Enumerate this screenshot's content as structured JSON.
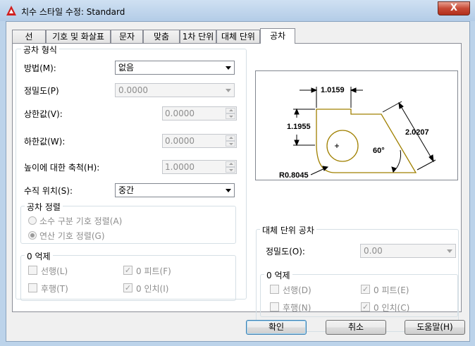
{
  "window": {
    "title": "치수 스타일 수정: Standard",
    "close_glyph": "X"
  },
  "tabs": [
    {
      "label": "선",
      "active": false
    },
    {
      "label": "기호 및 화살표",
      "active": false
    },
    {
      "label": "문자",
      "active": false
    },
    {
      "label": "맞춤",
      "active": false
    },
    {
      "label": "1차 단위",
      "active": false
    },
    {
      "label": "대체 단위",
      "active": false
    },
    {
      "label": "공차",
      "active": true
    }
  ],
  "tolerance_format": {
    "title": "공차 형식",
    "method_label": "방법(M):",
    "method_value": "없음",
    "precision_label": "정밀도(P)",
    "precision_value": "0.0000",
    "upper_label": "상한값(V):",
    "upper_value": "0.0000",
    "lower_label": "하한값(W):",
    "lower_value": "0.0000",
    "scale_label": "높이에 대한 축척(H):",
    "scale_value": "1.0000",
    "vpos_label": "수직 위치(S):",
    "vpos_value": "중간"
  },
  "tolerance_alignment": {
    "title": "공차 정렬",
    "option1": "소수 구분 기호 정렬(A)",
    "option2": "연산 기호 정렬(G)",
    "selected": 2
  },
  "zero_suppress_left": {
    "title": "0 억제",
    "leading": "선행(L)",
    "trailing": "후행(T)",
    "zero_feet": "0 피트(F)",
    "zero_inches": "0 인치(I)",
    "leading_checked": false,
    "trailing_checked": false,
    "zero_feet_checked": true,
    "zero_inches_checked": true
  },
  "alt_unit_tolerance": {
    "title": "대체 단위 공차",
    "precision_label": "정밀도(O):",
    "precision_value": "0.00"
  },
  "zero_suppress_right": {
    "title": "0 억제",
    "leading": "선행(D)",
    "trailing": "후행(N)",
    "zero_feet": "0 피트(E)",
    "zero_inches": "0 인치(C)",
    "leading_checked": false,
    "trailing_checked": false,
    "zero_feet_checked": true,
    "zero_inches_checked": true
  },
  "preview": {
    "dim_top": "1.0159",
    "dim_left": "1.1955",
    "dim_right": "2.0207",
    "angle": "60°",
    "radius": "R0.8045",
    "line_color": "#a08000"
  },
  "buttons": {
    "ok": "확인",
    "cancel": "취소",
    "help": "도움말(H)"
  },
  "colors": {
    "accent": "#3c7fb1",
    "titlebar": "#bcd3ea",
    "close": "#c74a36"
  }
}
